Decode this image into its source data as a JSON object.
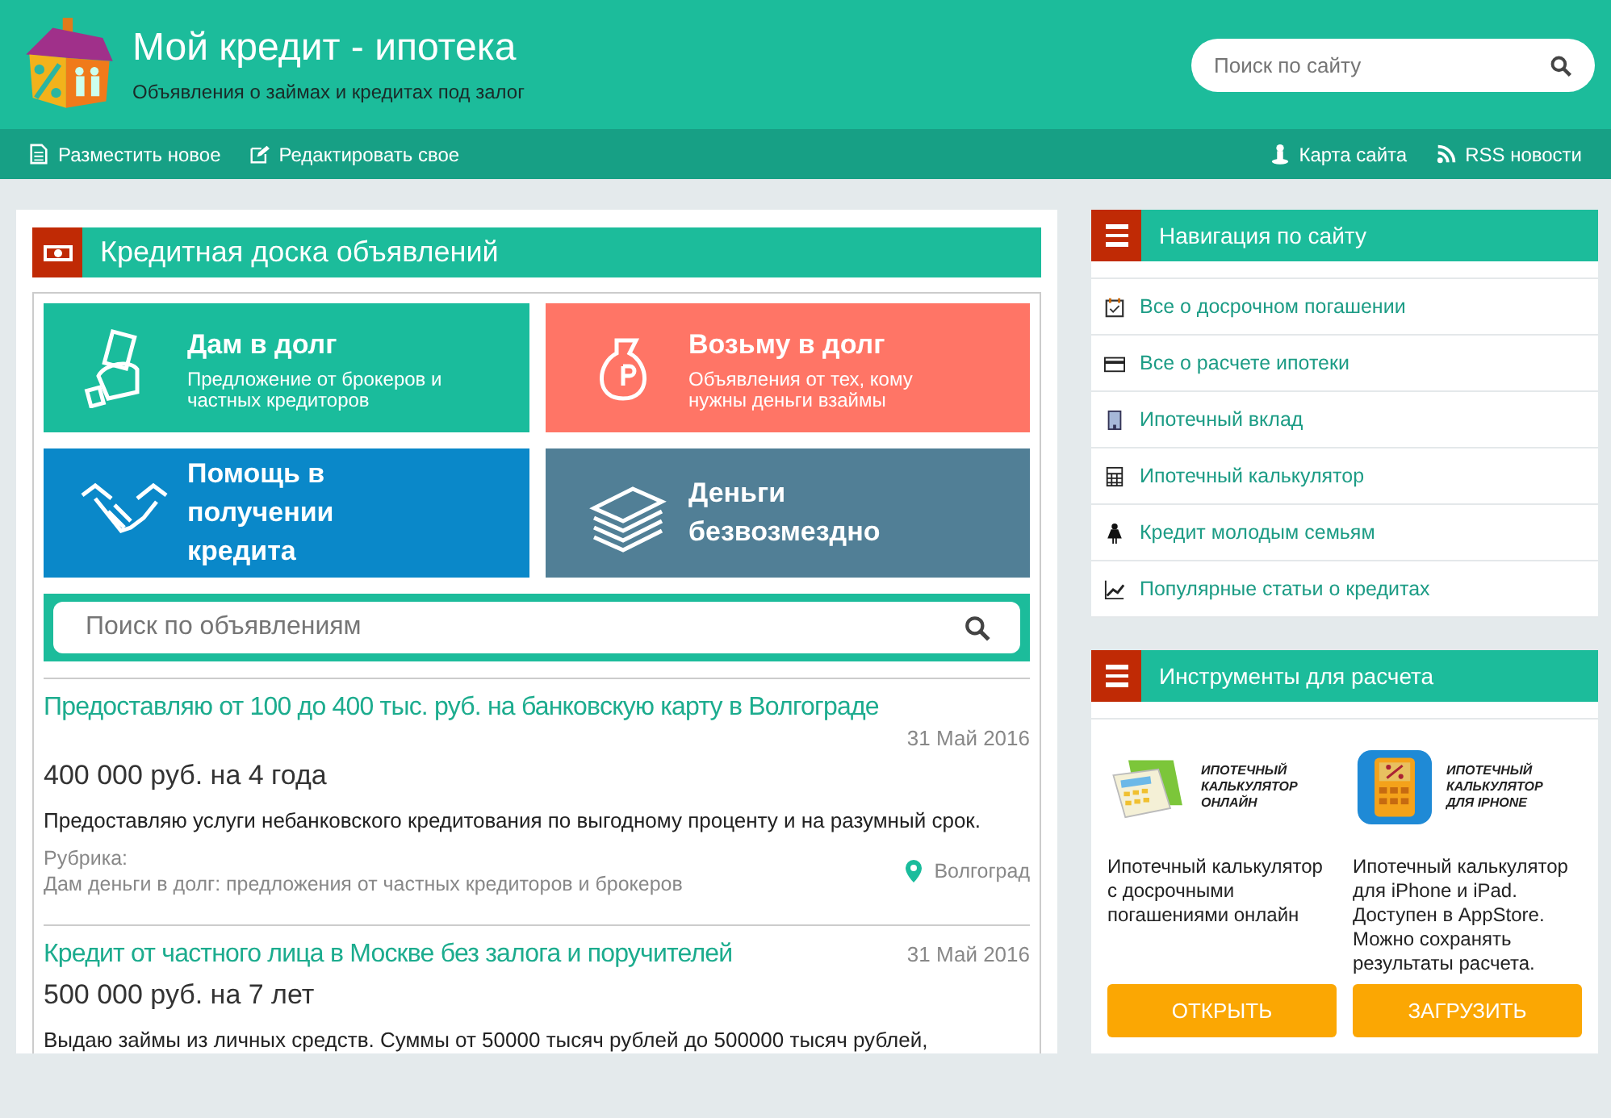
{
  "header": {
    "title": "Мой кредит - ипотека",
    "subtitle": "Объявления о займах и кредитах под залог",
    "search": {
      "placeholder": "Поиск по сайту"
    }
  },
  "nav_left": [
    {
      "label": "Разместить новое"
    },
    {
      "label": "Редактировать свое"
    }
  ],
  "nav_right": [
    {
      "label": "Карта сайта"
    },
    {
      "label": "RSS новости"
    }
  ],
  "board": {
    "title": "Кредитная доска объявлений",
    "tiles": [
      {
        "title": "Дам в долг",
        "subtitle": "Предложение от брокеров и частных кредиторов",
        "color": "#1abc9c"
      },
      {
        "title": "Возьму в долг",
        "subtitle": "Объявления от тех, кому нужны деньги взаймы",
        "color": "#ff7566"
      },
      {
        "title": "Помощь в получении кредита",
        "color": "#0a88c9"
      },
      {
        "title": "Деньги безвозмездно",
        "color": "#517f96"
      }
    ],
    "search": {
      "placeholder": "Поиск по объявлениям"
    },
    "listings": [
      {
        "title": "Предоставляю от 100 до 400 тыс. руб. на банковскую карту в Волгограде",
        "date": "31 Май 2016",
        "amount": "400 000 руб. на  4 года",
        "description": "Предоставляю услуги небанковского кредитования по выгодному проценту и на разумный срок.",
        "category_label": "Рубрика:",
        "category": "Дам деньги в долг: предложения от частных кредиторов и брокеров",
        "city": "Волгоград"
      },
      {
        "title": "Кредит от частного лица в Москве без залога и поручителей",
        "date": "31 Май 2016",
        "amount": "500 000 руб. на  7 лет",
        "description": "Выдаю займы из личных средств. Суммы от 50000 тысяч рублей до 500000 тысяч рублей,"
      }
    ]
  },
  "navigation": {
    "title": "Навигация по сайту",
    "items": [
      {
        "label": "Все о досрочном погашении"
      },
      {
        "label": "Все о расчете ипотеки"
      },
      {
        "label": "Ипотечный вклад"
      },
      {
        "label": "Ипотечный калькулятор"
      },
      {
        "label": "Кредит молодым семьям"
      },
      {
        "label": "Популярные статьи о кредитах"
      }
    ]
  },
  "tools": {
    "title": "Инструменты для расчета",
    "cards": [
      {
        "banner_text": "ИПОТЕЧНЫЙ КАЛЬКУЛЯТОР ОНЛАЙН",
        "description": "Ипотечный калькулятор с досрочными погашениями онлайн",
        "button": "ОТКРЫТЬ"
      },
      {
        "banner_text": "ИПОТЕЧНЫЙ КАЛЬКУЛЯТОР ДЛЯ IPHONE",
        "description": "Ипотечный калькулятор для iPhone и iPad. Доступен в AppStore. Можно сохранять результаты расчета.",
        "button": "ЗАГРУЗИТЬ"
      }
    ]
  }
}
